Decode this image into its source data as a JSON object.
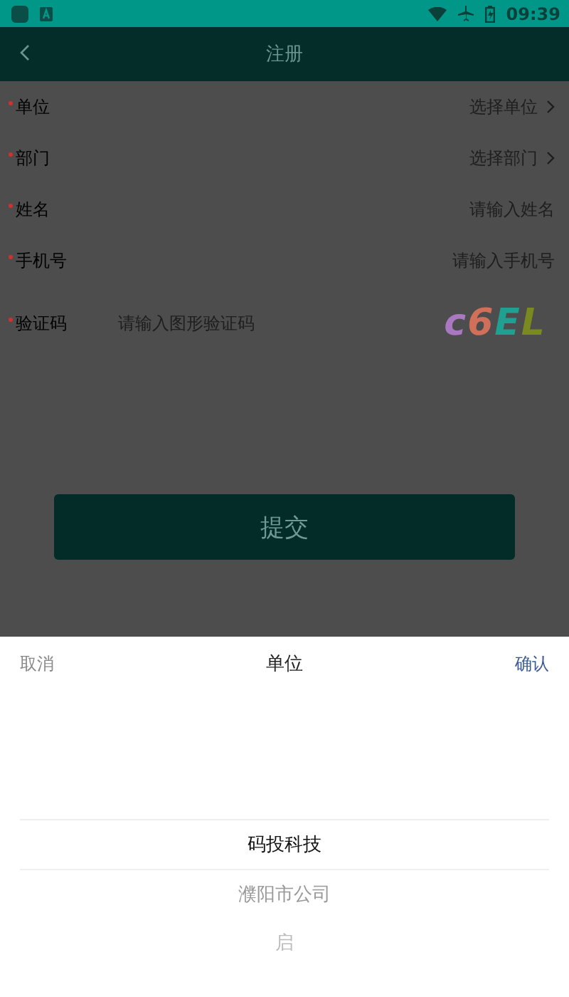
{
  "status_bar": {
    "time": "09:39"
  },
  "header": {
    "title": "注册"
  },
  "form": {
    "fields": [
      {
        "label": "单位",
        "kind": "select",
        "placeholder": "选择单位",
        "required": true
      },
      {
        "label": "部门",
        "kind": "select",
        "placeholder": "选择部门",
        "required": true
      },
      {
        "label": "姓名",
        "kind": "input",
        "placeholder": "请输入姓名",
        "required": true
      },
      {
        "label": "手机号",
        "kind": "input",
        "placeholder": "请输入手机号",
        "required": true
      },
      {
        "label": "验证码",
        "kind": "captcha",
        "placeholder": "请输入图形验证码",
        "required": true,
        "captcha": [
          {
            "char": "c",
            "color": "#a878c0"
          },
          {
            "char": "6",
            "color": "#d0705a"
          },
          {
            "char": "E",
            "color": "#20a090"
          },
          {
            "char": "L",
            "color": "#7a8a20"
          }
        ]
      }
    ],
    "submit": "提交"
  },
  "picker": {
    "cancel": "取消",
    "title": "单位",
    "confirm": "确认",
    "items": [
      {
        "label": "码投科技",
        "selected": true
      },
      {
        "label": "濮阳市公司",
        "selected": false
      },
      {
        "label": "启",
        "selected": false
      }
    ]
  }
}
